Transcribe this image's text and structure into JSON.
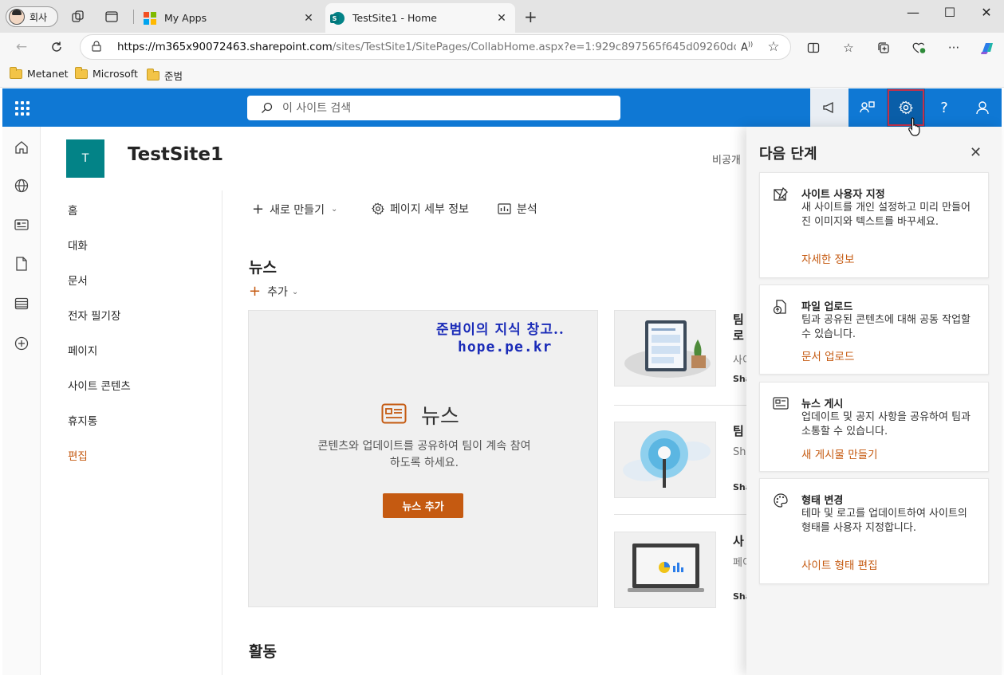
{
  "browser": {
    "profile_label": "회사",
    "tabs": [
      {
        "title": "My Apps",
        "active": false
      },
      {
        "title": "TestSite1 - Home",
        "active": true
      }
    ],
    "url_host": "https://m365x90072463.sharepoint.com",
    "url_path": "/sites/TestSite1/SitePages/CollabHome.aspx?e=1:929c897565f645d09260dc0b37...",
    "favorites": [
      "Metanet",
      "Microsoft",
      "준범"
    ]
  },
  "suite": {
    "search_placeholder": "이 사이트 검색"
  },
  "site": {
    "logo_letter": "T",
    "title": "TestSite1",
    "privacy": "비공개"
  },
  "nav": {
    "items": [
      "홈",
      "대화",
      "문서",
      "전자 필기장",
      "페이지",
      "사이트 콘텐츠",
      "휴지통"
    ],
    "edit_label": "편집"
  },
  "commands": {
    "new_label": "새로 만들기",
    "page_details_label": "페이지 세부 정보",
    "analytics_label": "분석"
  },
  "news": {
    "heading": "뉴스",
    "add_label": "추가",
    "watermark_line1": "준범이의 지식 창고..",
    "watermark_line2": "hope.pe.kr",
    "hero_title": "뉴스",
    "hero_desc": "콘텐츠와 업데이트를 공유하여 팀이 계속 참여하도록 하세요.",
    "hero_button": "뉴스 추가",
    "items": [
      {
        "title_line1": "팀",
        "title_line2": "로",
        "sub": "사이",
        "by": "Sha"
      },
      {
        "title_line1": "팀",
        "sub": "Sha",
        "by": "Sha"
      },
      {
        "title_line1": "사",
        "sub": "페이",
        "by": "Sha"
      }
    ]
  },
  "activity": {
    "heading": "활동"
  },
  "panel": {
    "title": "다음 단계",
    "cards": [
      {
        "icon": "customize-icon",
        "title": "사이트 사용자 지정",
        "desc": "새 사이트를 개인 설정하고 미리 만들어진 이미지와 텍스트를 바꾸세요.",
        "link": "자세한 정보"
      },
      {
        "icon": "file-upload-icon",
        "title": "파일 업로드",
        "desc": "팀과 공유된 콘텐츠에 대해 공동 작업할 수 있습니다.",
        "link": "문서 업로드"
      },
      {
        "icon": "news-post-icon",
        "title": "뉴스 게시",
        "desc": "업데이트 및 공지 사항을 공유하여 팀과 소통할 수 있습니다.",
        "link": "새 게시물 만들기"
      },
      {
        "icon": "palette-icon",
        "title": "형태 변경",
        "desc": "테마 및 로고를 업데이트하여 사이트의 형태를 사용자 지정합니다.",
        "link": "사이트 형태 편집"
      }
    ]
  },
  "colors": {
    "suite_bar": "#0f78d4",
    "accent": "#c55a11",
    "site_logo": "#038387",
    "settings_highlight": "#c4314b"
  }
}
